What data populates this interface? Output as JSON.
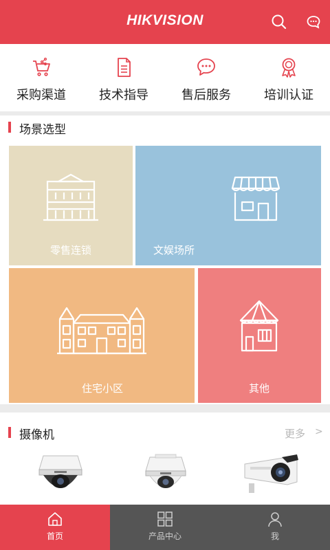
{
  "header": {
    "logo_text": "HIKVISION",
    "search_icon": "search-icon",
    "message_icon": "message-icon",
    "color": "#e5434e"
  },
  "quick_nav": {
    "items": [
      {
        "label": "采购渠道",
        "icon": "cart-icon"
      },
      {
        "label": "技术指导",
        "icon": "document-icon"
      },
      {
        "label": "售后服务",
        "icon": "chat-icon"
      },
      {
        "label": "培训认证",
        "icon": "award-icon"
      }
    ]
  },
  "scenes": {
    "title": "场景选型",
    "tiles": [
      {
        "label": "零售连锁",
        "icon": "building-icon",
        "color": "#e6dcc0"
      },
      {
        "label": "文娱场所",
        "icon": "storefront-icon",
        "color": "#99c2dc"
      },
      {
        "label": "住宅小区",
        "icon": "residential-icon",
        "color": "#f1b982"
      },
      {
        "label": "其他",
        "icon": "house-icon",
        "color": "#ef7f7f"
      }
    ]
  },
  "cameras": {
    "title": "摄像机",
    "more_label": "更多",
    "more_chevron": ">",
    "items": [
      {
        "icon": "dome-camera-icon"
      },
      {
        "icon": "dome-camera-icon"
      },
      {
        "icon": "bullet-camera-icon"
      }
    ]
  },
  "bottom_nav": {
    "items": [
      {
        "label": "首页",
        "icon": "home-icon",
        "active": true
      },
      {
        "label": "产品中心",
        "icon": "grid-icon",
        "active": false
      },
      {
        "label": "我",
        "icon": "user-icon",
        "active": false
      }
    ],
    "active_color": "#e5434e",
    "bar_color": "#555555"
  }
}
